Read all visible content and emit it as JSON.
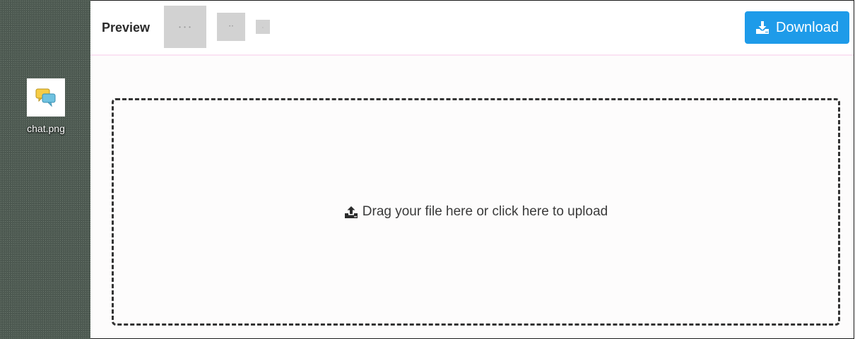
{
  "desktop": {
    "file": {
      "name": "chat.png",
      "icon": "chat-bubbles-icon"
    }
  },
  "toolbar": {
    "title": "Preview",
    "thumbnails": [
      {
        "icon": "preview-thumbnail-large"
      },
      {
        "icon": "preview-thumbnail-medium"
      },
      {
        "icon": "preview-thumbnail-small"
      }
    ],
    "download": {
      "label": "Download",
      "icon": "download-icon",
      "color": "#1e9be9"
    }
  },
  "dropzone": {
    "text": "Drag your file here or click here to upload",
    "icon": "upload-icon"
  },
  "colors": {
    "desktop_bg": "#4e5a52",
    "toolbar_divider": "#fbe3f3",
    "accent": "#1e9be9"
  }
}
